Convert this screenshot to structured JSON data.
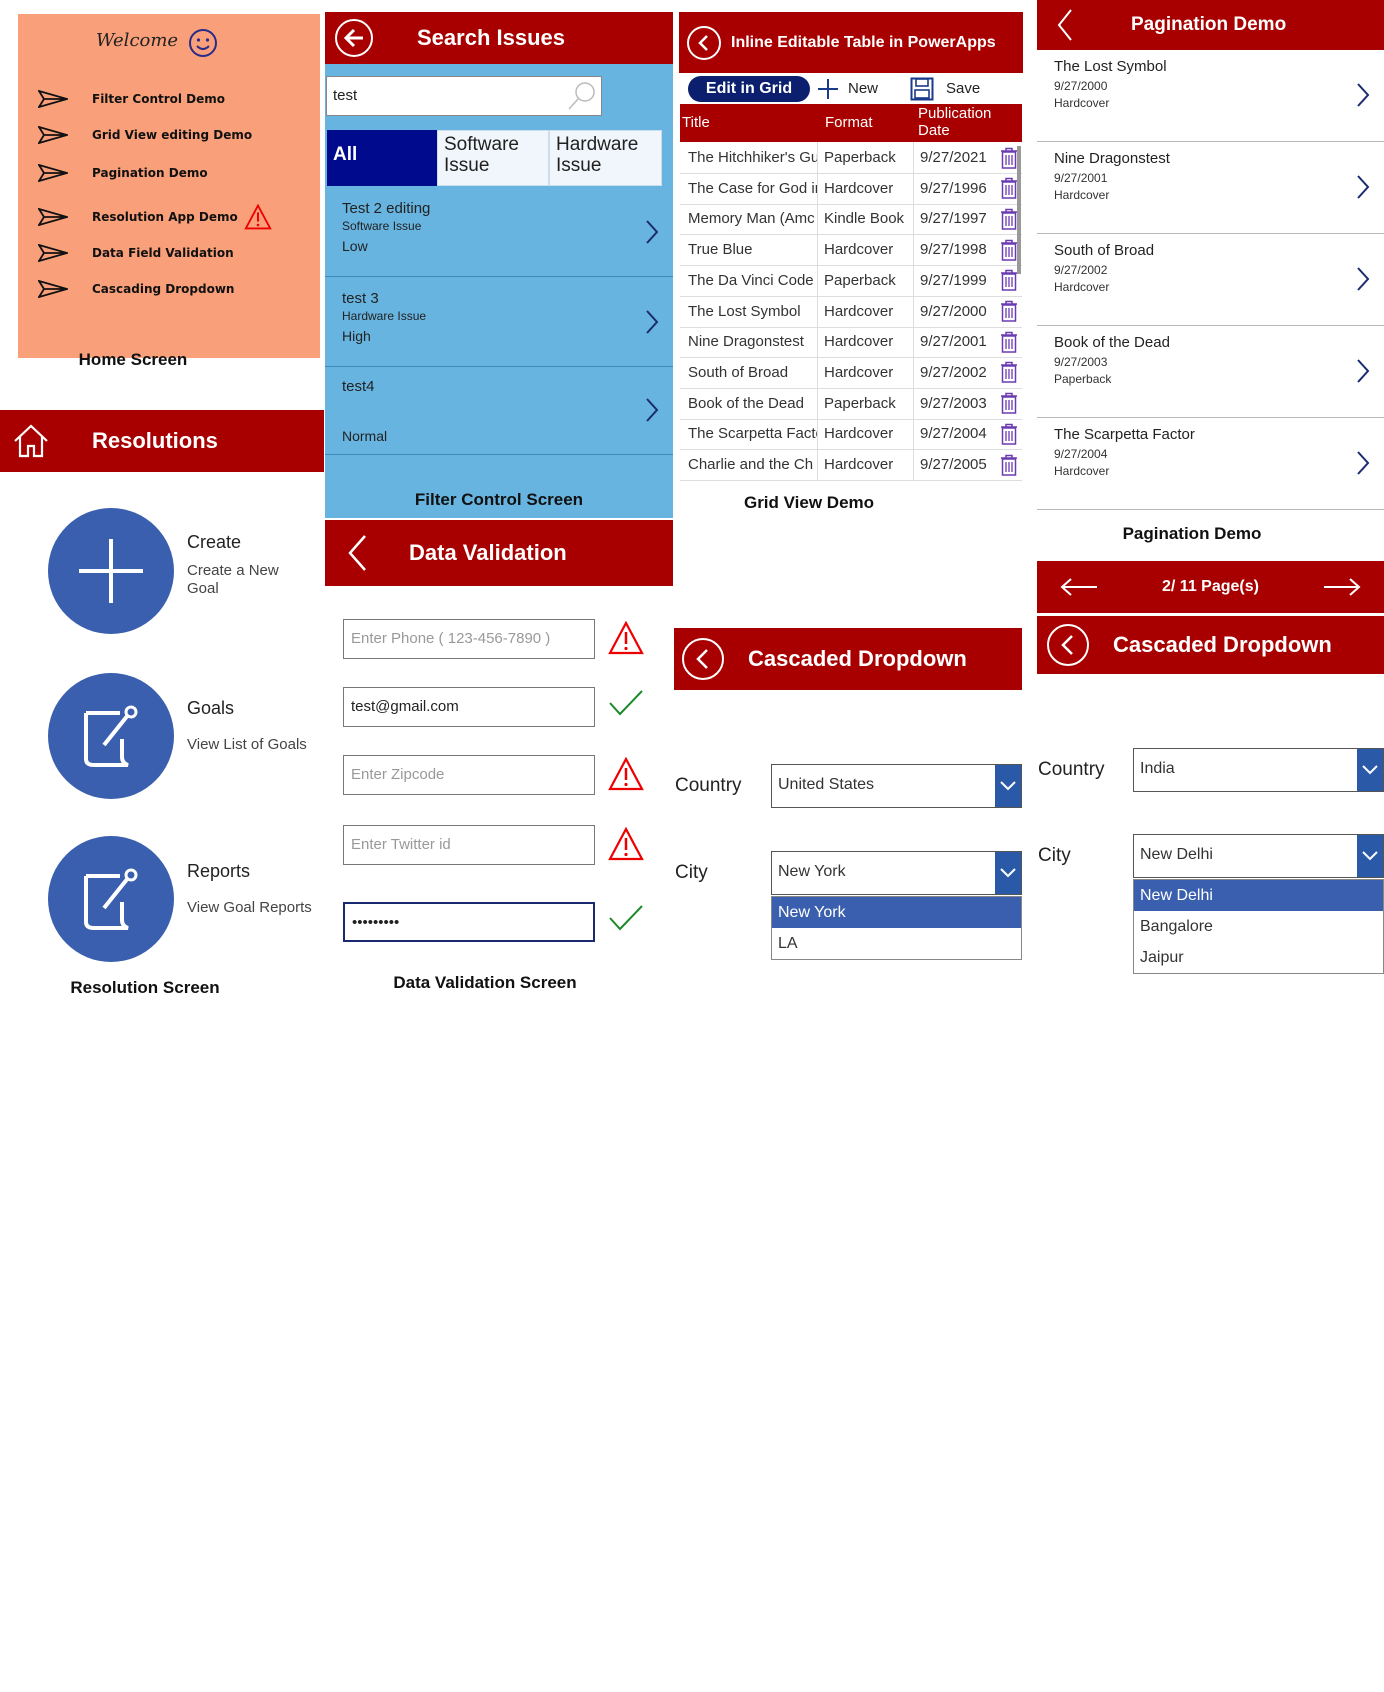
{
  "home": {
    "welcome": "Welcome",
    "items": [
      "Filter Control Demo",
      "Grid View editing Demo",
      "Pagination Demo",
      "Resolution App Demo",
      "Data Field Validation",
      "Cascading Dropdown"
    ],
    "caption": "Home Screen"
  },
  "search": {
    "title": "Search Issues",
    "query": "test",
    "tabs": [
      "All",
      "Software Issue",
      "Hardware Issue"
    ],
    "issues": [
      {
        "title": "Test 2 editing",
        "type": "Software Issue",
        "priority": "Low"
      },
      {
        "title": "test 3",
        "type": "Hardware Issue",
        "priority": "High"
      },
      {
        "title": "test4",
        "type": "",
        "priority": "Normal"
      }
    ],
    "caption": "Filter Control Screen"
  },
  "grid": {
    "title": "Inline Editable Table in PowerApps",
    "edit_label": "Edit in Grid",
    "new_label": "New",
    "save_label": "Save",
    "headers": [
      "Title",
      "Format",
      "Publication Date"
    ],
    "rows": [
      [
        "The Hitchhiker's Gu",
        "Paperback",
        "9/27/2021"
      ],
      [
        "The Case for God ir",
        "Hardcover",
        "9/27/1996"
      ],
      [
        "Memory Man (Amc",
        "Kindle Book",
        "9/27/1997"
      ],
      [
        "True Blue",
        "Hardcover",
        "9/27/1998"
      ],
      [
        "The Da Vinci Code",
        "Paperback",
        "9/27/1999"
      ],
      [
        "The Lost Symbol",
        "Hardcover",
        "9/27/2000"
      ],
      [
        "Nine Dragonstest",
        "Hardcover",
        "9/27/2001"
      ],
      [
        "South of Broad",
        "Hardcover",
        "9/27/2002"
      ],
      [
        "Book of the Dead",
        "Paperback",
        "9/27/2003"
      ],
      [
        "The Scarpetta Facto",
        "Hardcover",
        "9/27/2004"
      ],
      [
        "Charlie and the Ch",
        "Hardcover",
        "9/27/2005"
      ]
    ],
    "caption": "Grid View Demo"
  },
  "pagination": {
    "title": "Pagination Demo",
    "items": [
      {
        "title": "The Lost Symbol",
        "date": "9/27/2000",
        "format": "Hardcover"
      },
      {
        "title": "Nine Dragonstest",
        "date": "9/27/2001",
        "format": "Hardcover"
      },
      {
        "title": "South of Broad",
        "date": "9/27/2002",
        "format": "Hardcover"
      },
      {
        "title": "Book of the Dead",
        "date": "9/27/2003",
        "format": "Paperback"
      },
      {
        "title": "The Scarpetta Factor",
        "date": "9/27/2004",
        "format": "Hardcover"
      }
    ],
    "caption": "Pagination Demo",
    "page_text": "2/ 11 Page(s)"
  },
  "resolutions": {
    "title": "Resolutions",
    "items": [
      {
        "title": "Create",
        "subtitle": "Create a New Goal"
      },
      {
        "title": "Goals",
        "subtitle": "View List of Goals"
      },
      {
        "title": "Reports",
        "subtitle": "View Goal Reports"
      }
    ],
    "caption": "Resolution Screen"
  },
  "validation": {
    "title": "Data Validation",
    "fields": [
      {
        "placeholder": "Enter Phone ( 123-456-7890 )",
        "value": "",
        "status": "warning"
      },
      {
        "placeholder": "",
        "value": "test@gmail.com",
        "status": "ok"
      },
      {
        "placeholder": "Enter Zipcode",
        "value": "",
        "status": "warning"
      },
      {
        "placeholder": "Enter Twitter id",
        "value": "",
        "status": "warning"
      },
      {
        "placeholder": "",
        "value": "•••••••••",
        "status": "ok"
      }
    ],
    "caption": "Data Validation Screen"
  },
  "cascade_us": {
    "title": "Cascaded Dropdown",
    "country_label": "Country",
    "country_value": "United States",
    "city_label": "City",
    "city_value": "New York",
    "city_options": [
      "New York",
      "LA"
    ]
  },
  "cascade_in": {
    "title": "Cascaded Dropdown",
    "country_label": "Country",
    "country_value": "India",
    "city_label": "City",
    "city_value": "New Delhi",
    "city_options": [
      "New Delhi",
      "Bangalore",
      "Jaipur"
    ]
  },
  "colors": {
    "brand_red": "#a80000",
    "panel_blue": "#67b4e0",
    "accent_blue": "#3a5fae",
    "home_bg": "#f9a07a"
  }
}
